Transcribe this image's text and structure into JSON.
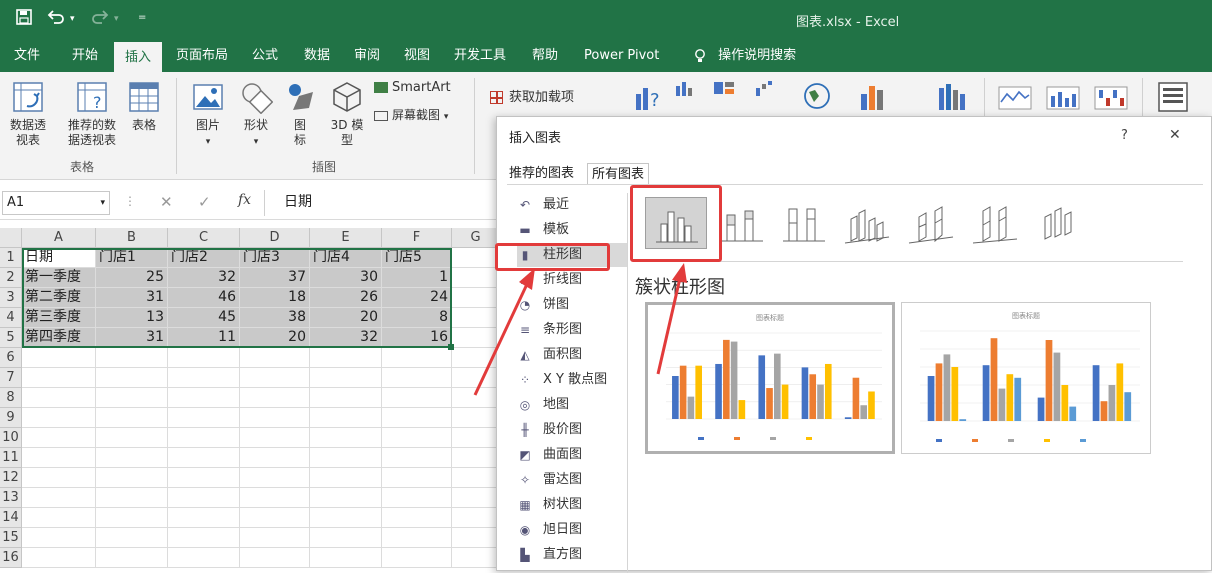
{
  "window": {
    "title": "图表.xlsx  -  Excel"
  },
  "quick_access": {
    "save_icon": "save-icon",
    "undo_icon": "undo-icon",
    "redo_icon": "redo-icon",
    "customize_icon": "customize-icon"
  },
  "menu_tabs": [
    {
      "label": "文件"
    },
    {
      "label": "开始"
    },
    {
      "label": "插入"
    },
    {
      "label": "页面布局"
    },
    {
      "label": "公式"
    },
    {
      "label": "数据"
    },
    {
      "label": "审阅"
    },
    {
      "label": "视图"
    },
    {
      "label": "开发工具"
    },
    {
      "label": "帮助"
    },
    {
      "label": "Power Pivot"
    },
    {
      "label": "操作说明搜索"
    }
  ],
  "ribbon": {
    "pivot_table": "数据透视表",
    "recommended_pivot": "推荐的数据透视表",
    "table": "表格",
    "group_tables": "表格",
    "pictures": "图片",
    "shapes": "形状",
    "icons": "图标",
    "models_3d": "3D 模型",
    "smartart": "SmartArt",
    "screenshot": "屏幕截图",
    "group_illustrations": "插图",
    "addins": "获取加载项"
  },
  "formula_bar": {
    "name_box": "A1",
    "formula": "日期",
    "cancel": "✕",
    "enter": "✓",
    "fx": "fx"
  },
  "sheet": {
    "columns": [
      "A",
      "B",
      "C",
      "D",
      "E",
      "F",
      "G"
    ],
    "rows": [
      "1",
      "2",
      "3",
      "4",
      "5",
      "6",
      "7",
      "8",
      "9",
      "10",
      "11",
      "12",
      "13",
      "14",
      "15",
      "16"
    ],
    "cells": [
      [
        "日期",
        "门店1",
        "门店2",
        "门店3",
        "门店4",
        "门店5"
      ],
      [
        "第一季度",
        "25",
        "32",
        "37",
        "30",
        "1"
      ],
      [
        "第二季度",
        "31",
        "46",
        "18",
        "26",
        "24"
      ],
      [
        "第三季度",
        "13",
        "45",
        "38",
        "20",
        "8"
      ],
      [
        "第四季度",
        "31",
        "11",
        "20",
        "32",
        "16"
      ]
    ]
  },
  "dialog": {
    "title": "插入图表",
    "help": "?",
    "close": "✕",
    "tabs": [
      {
        "label": "推荐的图表"
      },
      {
        "label": "所有图表"
      }
    ],
    "nav": [
      {
        "label": "最近",
        "icon": "recent-icon"
      },
      {
        "label": "模板",
        "icon": "template-icon"
      },
      {
        "label": "柱形图",
        "icon": "column-chart-icon"
      },
      {
        "label": "折线图",
        "icon": "line-chart-icon"
      },
      {
        "label": "饼图",
        "icon": "pie-chart-icon"
      },
      {
        "label": "条形图",
        "icon": "bar-chart-icon"
      },
      {
        "label": "面积图",
        "icon": "area-chart-icon"
      },
      {
        "label": "X Y 散点图",
        "icon": "scatter-chart-icon"
      },
      {
        "label": "地图",
        "icon": "map-chart-icon"
      },
      {
        "label": "股价图",
        "icon": "stock-chart-icon"
      },
      {
        "label": "曲面图",
        "icon": "surface-chart-icon"
      },
      {
        "label": "雷达图",
        "icon": "radar-chart-icon"
      },
      {
        "label": "树状图",
        "icon": "treemap-chart-icon"
      },
      {
        "label": "旭日图",
        "icon": "sunburst-chart-icon"
      },
      {
        "label": "直方图",
        "icon": "histogram-chart-icon"
      }
    ],
    "subtype_title": "簇状柱形图",
    "preview_titles": [
      "图表标题",
      "图表标题"
    ],
    "colors": {
      "s1": "#4472c4",
      "s2": "#ed7d31",
      "s3": "#a5a5a5",
      "s4": "#ffc000",
      "s5": "#5b9bd5",
      "highlight": "#e23b3b",
      "excel_green": "#217346"
    }
  }
}
